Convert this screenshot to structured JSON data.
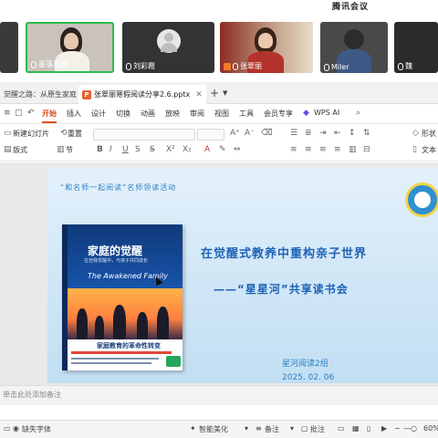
{
  "meeting": {
    "app_title": "腾讯会议",
    "participants": [
      {
        "name": ""
      },
      {
        "name": "墨落成画"
      },
      {
        "name": "刘彩霞"
      },
      {
        "name": "张翠丽"
      },
      {
        "name": "Miler"
      },
      {
        "name": "魏"
      }
    ]
  },
  "tabs": [
    {
      "label": "觉醒之路：从原生家庭到..."
    },
    {
      "label": "张翠丽寒假阅读分享2.6.pptx"
    }
  ],
  "menu": {
    "items": [
      "开始",
      "插入",
      "设计",
      "切换",
      "动画",
      "放映",
      "审阅",
      "视图",
      "工具",
      "会员专享"
    ],
    "wps_ai": "WPS AI"
  },
  "ribbon": {
    "new_slide": "新建幻灯片",
    "layout": "版式",
    "reset": "重置",
    "section": "节",
    "shape": "形状",
    "textbox": "文本"
  },
  "slide": {
    "header": "“和名师一起阅读”名师领读活动",
    "title": "在觉醒式教养中重构亲子世界",
    "subtitle": "——“星星河”共享读书会",
    "group": "星河阅读2组",
    "date": "2025. 02. 06",
    "book": {
      "title_cn": "家庭的觉醒",
      "title_sub": "在自我觉醒中，与孩子共同成长",
      "title_en": "The Awakened Family",
      "motto": "家庭教育的革命性转变"
    }
  },
  "notes": {
    "placeholder": "单击此处添加备注"
  },
  "status": {
    "missing_font": "缺失字体",
    "smart_beautify": "智能美化",
    "notes": "备注",
    "comments": "批注",
    "zoom": "60%"
  }
}
